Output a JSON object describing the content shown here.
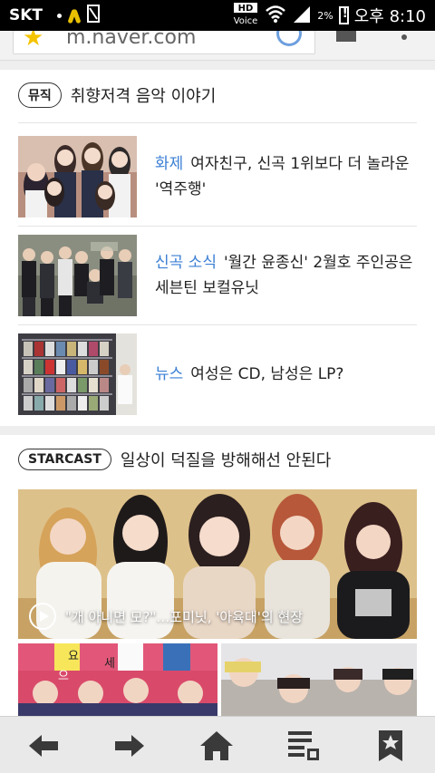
{
  "status_bar": {
    "carrier": "SKT",
    "hd_voice": "HD\nVoice",
    "battery_percent": "2%",
    "time": "오후 8:10",
    "icons": [
      "location-icon",
      "yellow-ribbon-icon",
      "sim-icon",
      "hd-voice-icon",
      "wifi-icon",
      "signal-icon",
      "battery-icon"
    ]
  },
  "browser": {
    "url": "m.naver.com",
    "icons": [
      "favorite-star-icon",
      "reload-icon",
      "tabs-icon",
      "menu-icon"
    ]
  },
  "music_section": {
    "badge": "뮤직",
    "title": "취향저격 음악 이야기",
    "items": [
      {
        "category": "화제",
        "headline": "여자친구, 신곡 1위보다 더 놀라운 '역주행'"
      },
      {
        "category": "신곡 소식",
        "headline": "'월간 윤종신' 2월호 주인공은 세븐틴 보컬유닛"
      },
      {
        "category": "뉴스",
        "headline": "여성은 CD, 남성은 LP?"
      }
    ]
  },
  "starcast_section": {
    "badge": "STARCAST",
    "title": "일상이 덕질을 방해해선 안된다",
    "video_caption": "\"개 아니면 모?\"…포미닛, '아육대'의 현장",
    "thumb_sign_text": "요 세 으 잘"
  },
  "bottom_nav": {
    "items": [
      "back",
      "forward",
      "home",
      "reader",
      "bookmarks"
    ],
    "icons": [
      "arrow-left-icon",
      "arrow-right-icon",
      "home-icon",
      "reader-mode-icon",
      "bookmark-icon"
    ]
  },
  "colors": {
    "accent_blue": "#3b7fd4",
    "statusbar": "#000000",
    "navbar": "#e9e9e9"
  }
}
